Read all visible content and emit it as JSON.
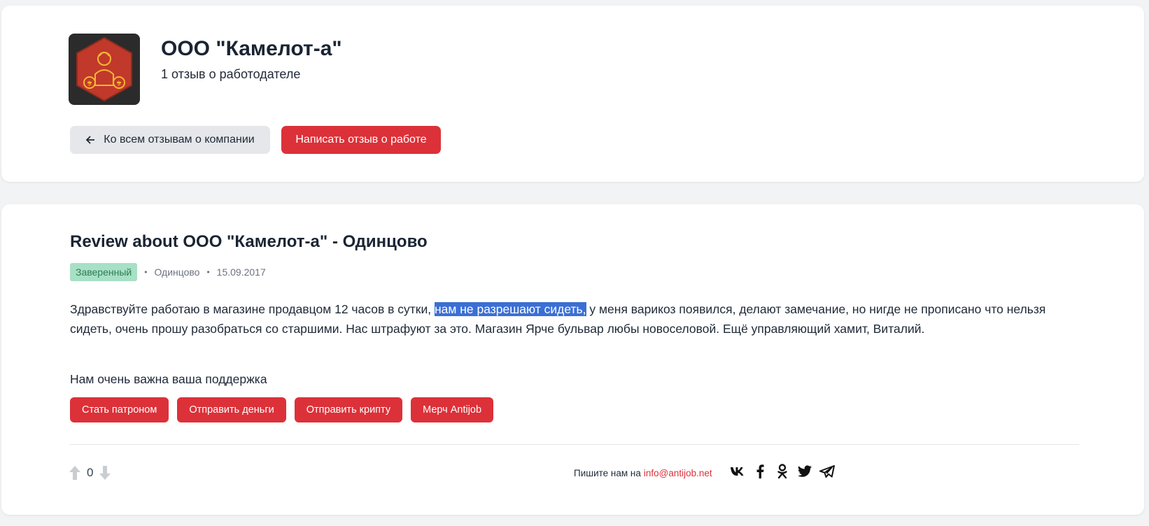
{
  "company": {
    "name": "ООО \"Камелот-а\"",
    "review_count": "1 отзыв о работодателе"
  },
  "actions": {
    "back_label": "Ко всем отзывам о компании",
    "write_label": "Написать отзыв о работе"
  },
  "review": {
    "title": "Review about ООО \"Камелот-а\" - Одинцово",
    "badge": "Заверенный",
    "city": "Одинцово",
    "date": "15.09.2017",
    "text_before": "Здравствуйте работаю в магазине продавцом 12 часов в сутки, ",
    "text_highlight": "нам не разрешают сидеть,",
    "text_after": " у меня варикоз появился, делают замечание, но нигде не прописано что нельзя сидеть, очень прошу разобраться со старшими. Нас штрафуют за это. Магазин Ярче бульвар любы новоселовой. Ещё управляющий хамит, Виталий."
  },
  "support": {
    "label": "Нам очень важна ваша поддержка",
    "buttons": [
      "Стать патроном",
      "Отправить деньги",
      "Отправить крипту",
      "Мерч Antijob"
    ]
  },
  "footer": {
    "votes": "0",
    "contact_prefix": "Пишите нам на",
    "contact_email": "info@antijob.net",
    "socials": [
      "vk-icon",
      "facebook-icon",
      "odnoklassniki-icon",
      "twitter-icon",
      "telegram-icon"
    ]
  },
  "colors": {
    "accent": "#dc3139",
    "badge_bg": "#a7e0c5",
    "badge_text": "#2e7d55",
    "highlight": "#3b6fd4"
  }
}
